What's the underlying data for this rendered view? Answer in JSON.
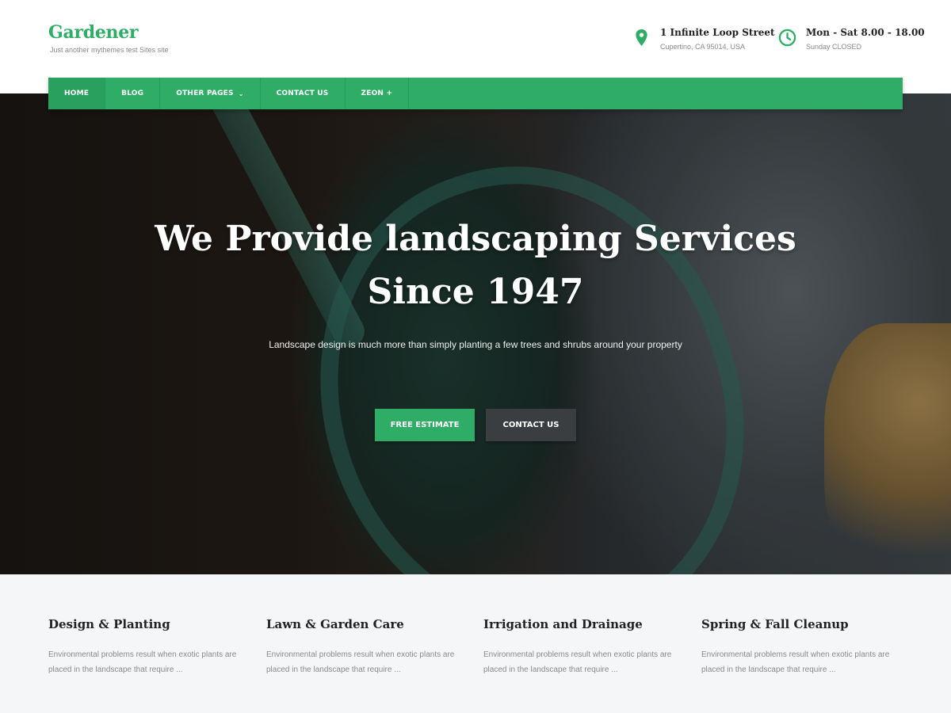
{
  "site": {
    "title": "Gardener",
    "tagline": "Just another mythemes test Sites site"
  },
  "contact_info": {
    "address_title": "1 Infinite Loop Street",
    "address_sub": "Cupertino, CA 95014, USA",
    "hours_title": "Mon - Sat 8.00 - 18.00",
    "hours_sub": "Sunday CLOSED",
    "address_icon": "map-pin-icon",
    "hours_icon": "clock-icon"
  },
  "nav": {
    "items": [
      {
        "label": "HOME"
      },
      {
        "label": "BLOG"
      },
      {
        "label": "OTHER PAGES",
        "caret": "⌄"
      },
      {
        "label": "CONTACT US"
      },
      {
        "label": "ZEON +"
      }
    ]
  },
  "hero": {
    "title_line1": "We Provide landscaping Services",
    "title_line2": "Since 1947",
    "subtitle": "Landscape design is much more than simply planting a few trees and shrubs around your property",
    "primary_button": "FREE ESTIMATE",
    "secondary_button": "CONTACT US"
  },
  "services": [
    {
      "title": "Design & Planting",
      "text_line1": "Environmental problems result when exotic plants are",
      "text_line2": "placed in the landscape that require ..."
    },
    {
      "title": "Lawn & Garden Care",
      "text_line1": "Environmental problems result when exotic plants are",
      "text_line2": "placed in the landscape that require ..."
    },
    {
      "title": "Irrigation and Drainage",
      "text_line1": "Environmental problems result when exotic plants are",
      "text_line2": "placed in the landscape that require ..."
    },
    {
      "title": "Spring & Fall Cleanup",
      "text_line1": "Environmental problems result when exotic plants are",
      "text_line2": "placed in the landscape that require ..."
    }
  ],
  "colors": {
    "brand": "#2fad66",
    "dark_button": "#3b3e41",
    "services_bg": "#f5f6f8"
  }
}
